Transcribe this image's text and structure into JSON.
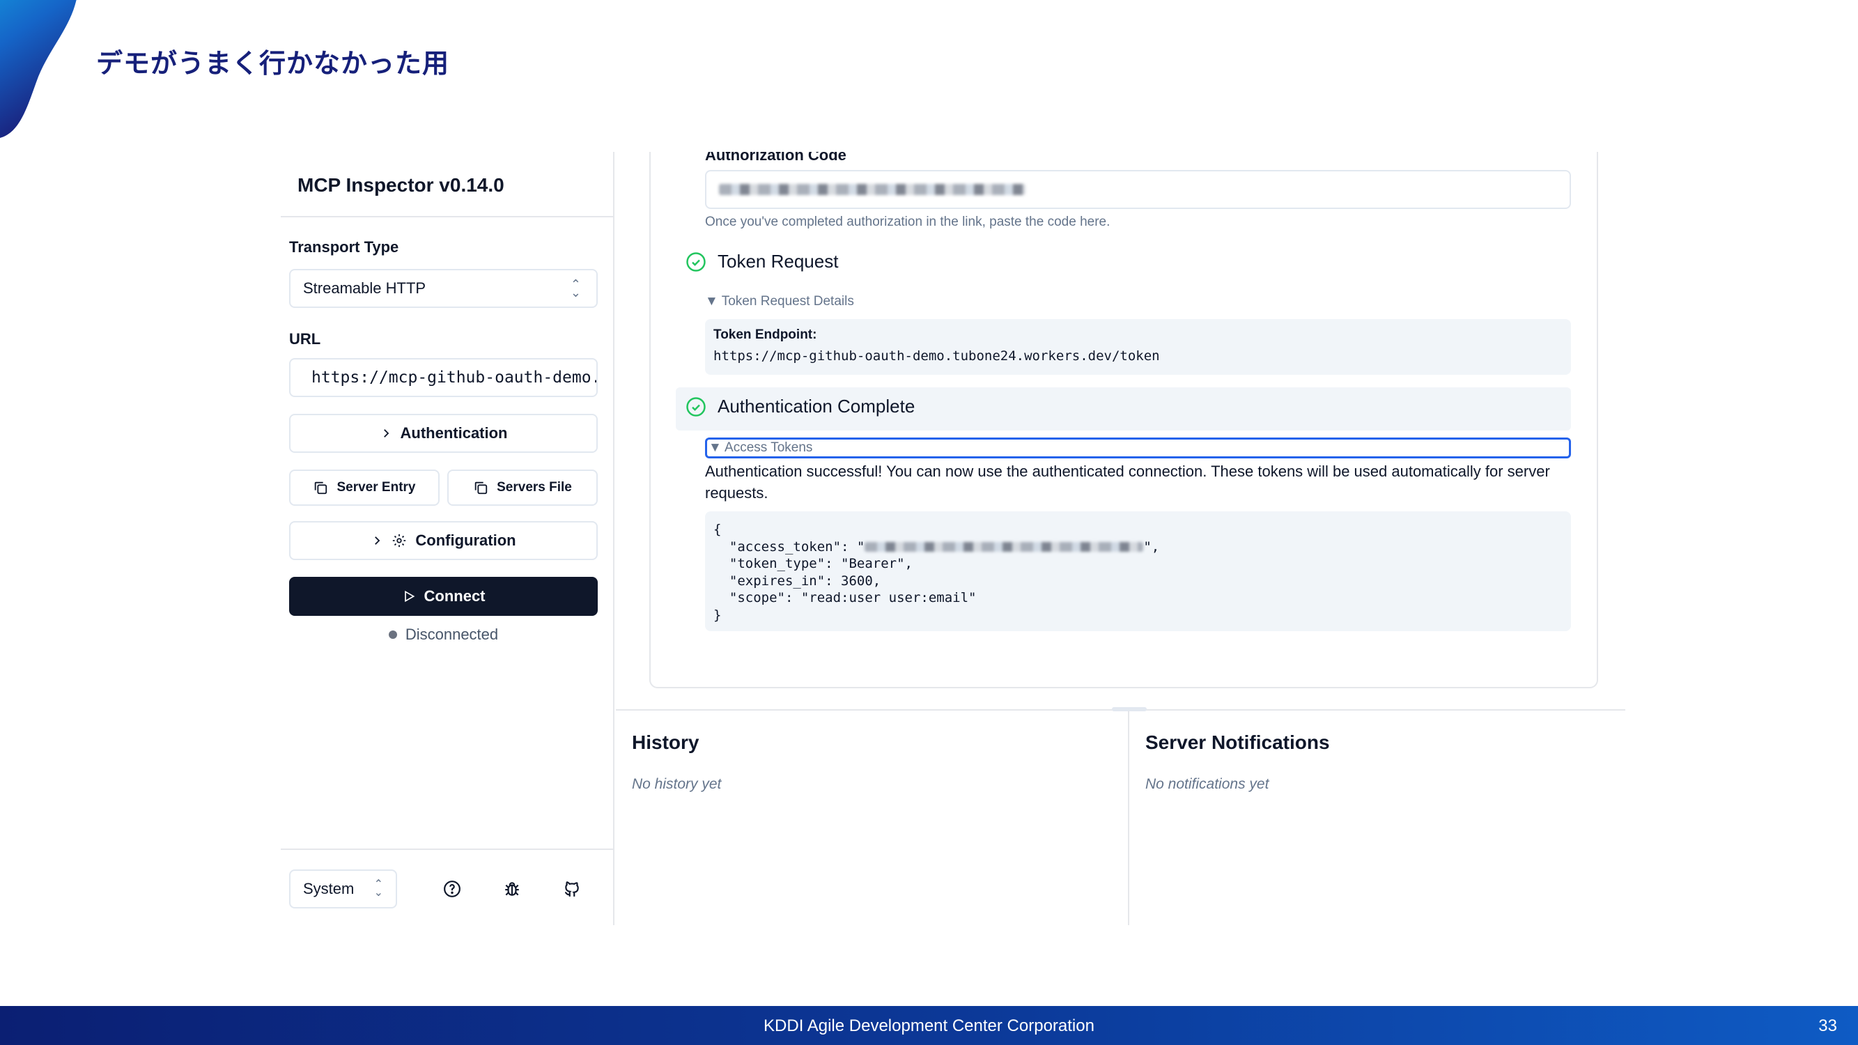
{
  "slide": {
    "title": "デモがうまく行かなかった用",
    "footer": "KDDI Agile Development Center Corporation",
    "page_number": "33",
    "colors": {
      "title": "#16207a",
      "footer_start": "#0b1f73",
      "footer_end": "#0e5bc4",
      "accent_blob": "#1a8fe0"
    }
  },
  "sidebar": {
    "title": "MCP Inspector v0.14.0",
    "transport_label": "Transport Type",
    "transport_value": "Streamable HTTP",
    "url_label": "URL",
    "url_value": "https://mcp-github-oauth-demo.",
    "authentication_button": "Authentication",
    "server_entry_button": "Server Entry",
    "servers_file_button": "Servers File",
    "configuration_button": "Configuration",
    "connect_button": "Connect",
    "status": "Disconnected",
    "theme_value": "System",
    "icons": [
      "help-circle-icon",
      "bug-icon",
      "github-icon"
    ]
  },
  "oauth_flow": {
    "auth_code_label": "Authorization Code",
    "auth_code_hint": "Once you've completed authorization in the link, paste the code here.",
    "token_request_step": "Token Request",
    "token_request_details": "▼ Token Request Details",
    "token_endpoint_label": "Token Endpoint:",
    "token_endpoint_url": "https://mcp-github-oauth-demo.tubone24.workers.dev/token",
    "auth_complete_step": "Authentication Complete",
    "access_tokens_summary": "▼ Access Tokens",
    "success_message": "Authentication successful! You can now use the authenticated connection. These tokens will be used automatically for server requests.",
    "json_lines": [
      "{",
      "  \"access_token\": \"",
      "  \"token_type\": \"Bearer\",",
      "  \"expires_in\": 3600,",
      "  \"scope\": \"read:user user:email\"",
      "}"
    ],
    "access_token_suffix": "\",",
    "step_color": "#22c55e"
  },
  "history": {
    "title": "History",
    "empty": "No history yet"
  },
  "notifications": {
    "title": "Server Notifications",
    "empty": "No notifications yet"
  }
}
